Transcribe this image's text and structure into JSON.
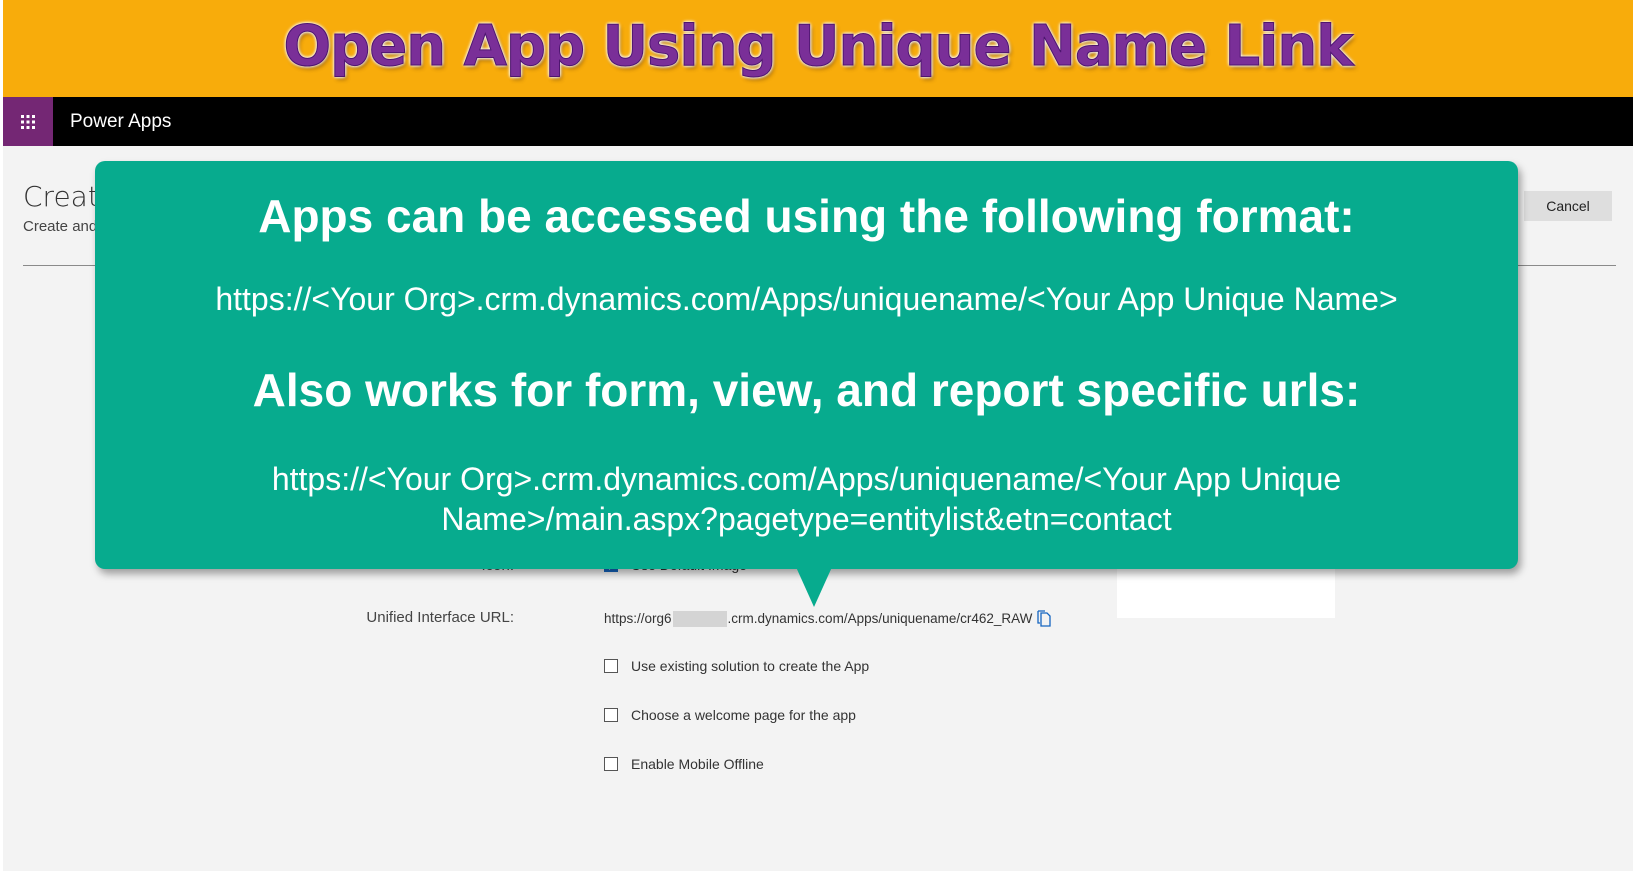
{
  "banner": {
    "title": "Open App Using Unique Name Link"
  },
  "appbar": {
    "app_name": "Power Apps",
    "waffle_icon": "waffle-icon"
  },
  "page": {
    "title": "Create",
    "subtitle": "Create and",
    "cancel_label": "Cancel"
  },
  "form": {
    "icon_label": "Icon:",
    "use_default_image": {
      "label": "Use Default Image",
      "checked": true
    },
    "url_label": "Unified Interface URL:",
    "url_prefix": "https://org6",
    "url_suffix": ".crm.dynamics.com/Apps/uniquename/cr462_RAW",
    "options": [
      {
        "label": "Use existing solution to create the App",
        "checked": false
      },
      {
        "label": "Choose a welcome page for the app",
        "checked": false
      },
      {
        "label": "Enable Mobile Offline",
        "checked": false
      }
    ]
  },
  "callout": {
    "heading1": "Apps can be accessed using the following format:",
    "text1": "https://<Your Org>.crm.dynamics.com/Apps/uniquename/<Your App Unique Name>",
    "heading2": "Also works for form, view, and report specific urls:",
    "text2": "https://<Your Org>.crm.dynamics.com/Apps/uniquename/<Your App Unique Name>/main.aspx?pagetype=entitylist&etn=contact"
  },
  "colors": {
    "banner": "#f8ac0b",
    "banner_text": "#7a2f98",
    "waffle": "#742774",
    "callout": "#07ab8e"
  }
}
